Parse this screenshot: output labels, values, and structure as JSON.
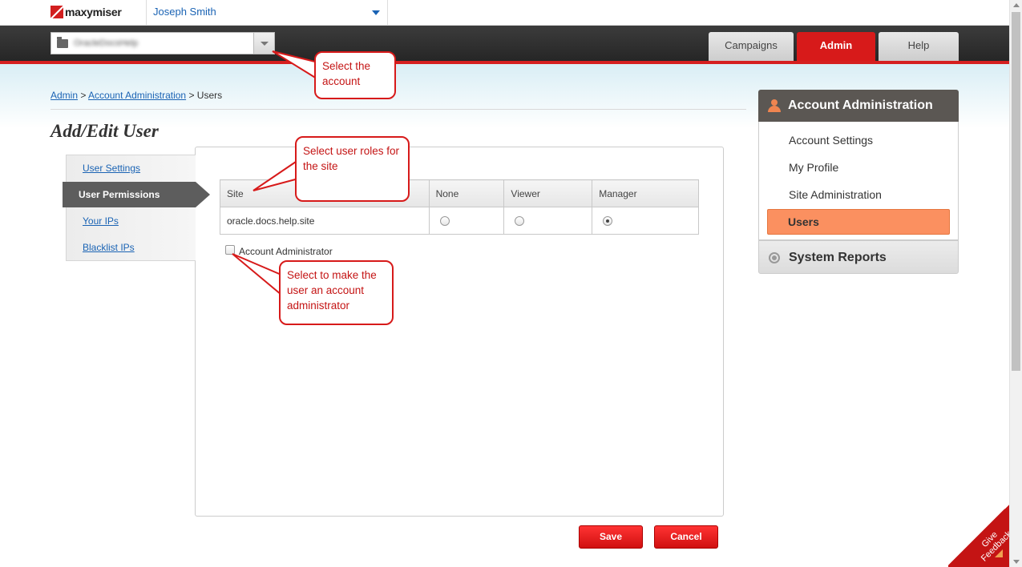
{
  "header": {
    "brand": "maxymiser",
    "user_name": "Joseph Smith",
    "account_value": "OracleDocsHelp",
    "tabs": [
      {
        "label": "Campaigns",
        "active": false
      },
      {
        "label": "Admin",
        "active": true
      },
      {
        "label": "Help",
        "active": false
      }
    ]
  },
  "breadcrumb": {
    "items": [
      {
        "label": "Admin",
        "link": true
      },
      {
        "label": "Account Administration",
        "link": true
      },
      {
        "label": "Users",
        "link": false
      }
    ],
    "separator": ">"
  },
  "page_title": "Add/Edit User",
  "left_tabs": [
    {
      "label": "User Settings",
      "active": false
    },
    {
      "label": "User Permissions",
      "active": true
    },
    {
      "label": "Your IPs",
      "active": false
    },
    {
      "label": "Blacklist IPs",
      "active": false
    }
  ],
  "permissions": {
    "columns": [
      "Site",
      "None",
      "Viewer",
      "Manager"
    ],
    "rows": [
      {
        "site": "oracle.docs.help.site",
        "selected": "Manager"
      }
    ]
  },
  "account_admin_label": "Account Administrator",
  "buttons": {
    "save": "Save",
    "cancel": "Cancel"
  },
  "sidebar": {
    "title": "Account Administration",
    "items": [
      {
        "label": "Account Settings",
        "active": false
      },
      {
        "label": "My Profile",
        "active": false
      },
      {
        "label": "Site Administration",
        "active": false
      },
      {
        "label": "Users",
        "active": true
      }
    ],
    "reports": "System Reports"
  },
  "callouts": {
    "account": "Select the account",
    "roles": "Select user roles for the site",
    "admin": "Select to make the user an account administrator"
  },
  "feedback": "Give Feedback",
  "colors": {
    "accent_red": "#d71a1a",
    "link_blue": "#1a63b4",
    "active_orange": "#fb9060",
    "dark_bar": "#2e2e2e"
  }
}
